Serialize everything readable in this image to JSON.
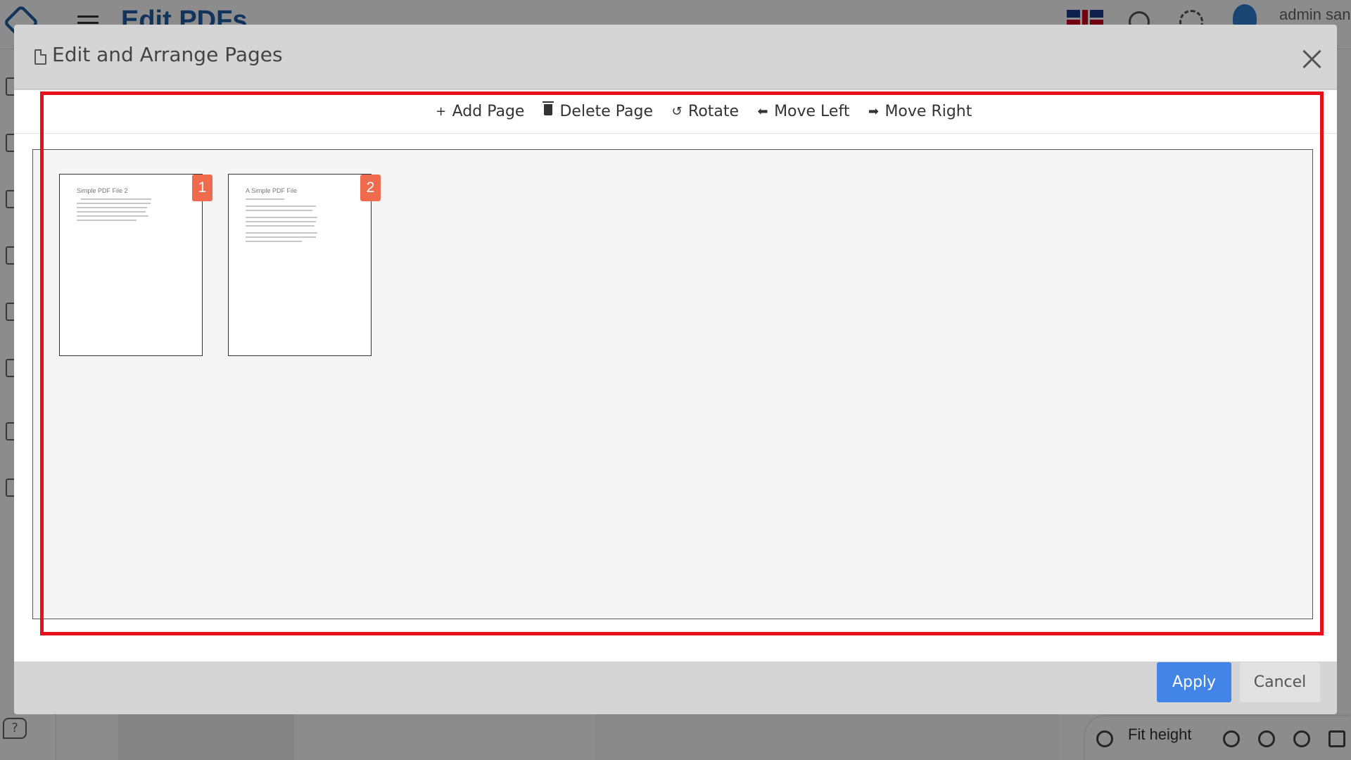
{
  "app": {
    "title": "Edit PDFs",
    "user_name": "admin san",
    "help_label": "?",
    "viewer": {
      "zoom_mode": "Fit height"
    }
  },
  "modal": {
    "title": "Edit and Arrange Pages",
    "toolbar": {
      "add_page": "Add Page",
      "delete_page": "Delete Page",
      "rotate": "Rotate",
      "move_left": "Move Left",
      "move_right": "Move Right"
    },
    "pages": [
      {
        "number": "1",
        "thumb_title": "Simple PDF File 2"
      },
      {
        "number": "2",
        "thumb_title": "A Simple PDF File"
      }
    ],
    "footer": {
      "apply": "Apply",
      "cancel": "Cancel"
    }
  },
  "colors": {
    "highlight": "#e8111b",
    "badge": "#f06a4d",
    "apply": "#4285e6",
    "brand": "#1f5fa8"
  }
}
